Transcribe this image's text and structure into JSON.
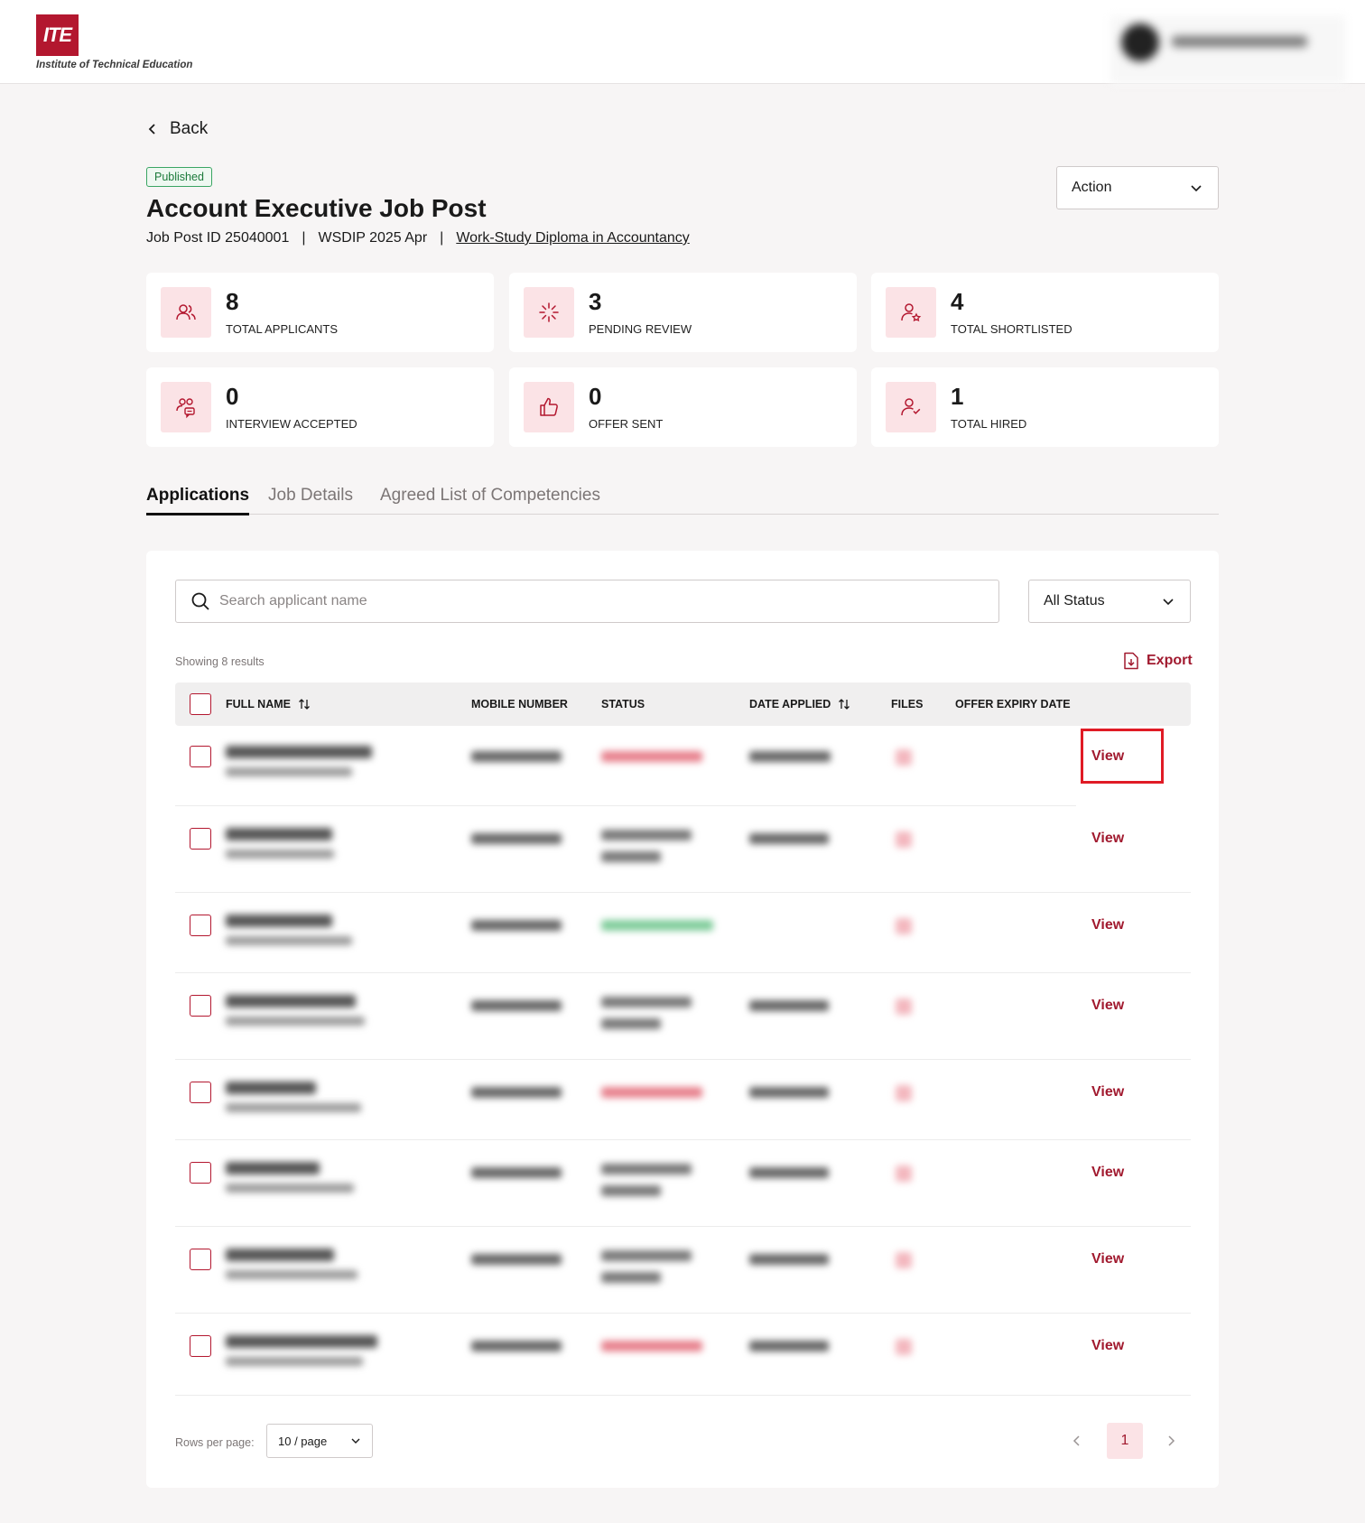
{
  "header": {
    "logo_mark": "ITE",
    "logo_text": "Institute of Technical Education"
  },
  "back_label": "Back",
  "job": {
    "status_badge": "Published",
    "title": "Account Executive Job Post",
    "post_id": "Job Post ID 25040001",
    "intake": "WSDIP 2025 Apr",
    "course_link": "Work-Study Diploma in Accountancy",
    "separator": "|"
  },
  "action_label": "Action",
  "stats": [
    {
      "value": "8",
      "label": "TOTAL APPLICANTS",
      "icon": "users-icon"
    },
    {
      "value": "3",
      "label": "PENDING REVIEW",
      "icon": "loader-icon"
    },
    {
      "value": "4",
      "label": "TOTAL SHORTLISTED",
      "icon": "user-star-icon"
    },
    {
      "value": "0",
      "label": "INTERVIEW ACCEPTED",
      "icon": "users-chat-icon"
    },
    {
      "value": "0",
      "label": "OFFER SENT",
      "icon": "thumbs-up-icon"
    },
    {
      "value": "1",
      "label": "TOTAL HIRED",
      "icon": "user-check-icon"
    }
  ],
  "tabs": [
    "Applications",
    "Job Details",
    "Agreed List of Competencies"
  ],
  "search": {
    "placeholder": "Search applicant name"
  },
  "status_filter": "All Status",
  "results_text": "Showing 8 results",
  "export_label": "Export",
  "columns": {
    "full_name": "FULL NAME",
    "mobile": "MOBILE NUMBER",
    "status": "STATUS",
    "date_applied": "DATE APPLIED",
    "files": "FILES",
    "offer_expiry": "OFFER EXPIRY DATE"
  },
  "row_action_label": "View",
  "rows_per_page_label": "Rows per page:",
  "rows_per_page_value": "10 / page",
  "current_page": "1",
  "colors": {
    "brand_red": "#b3172f",
    "link_red": "#a11a2f",
    "highlight_red": "#e01b25",
    "badge_green": "#1b7a3a"
  }
}
